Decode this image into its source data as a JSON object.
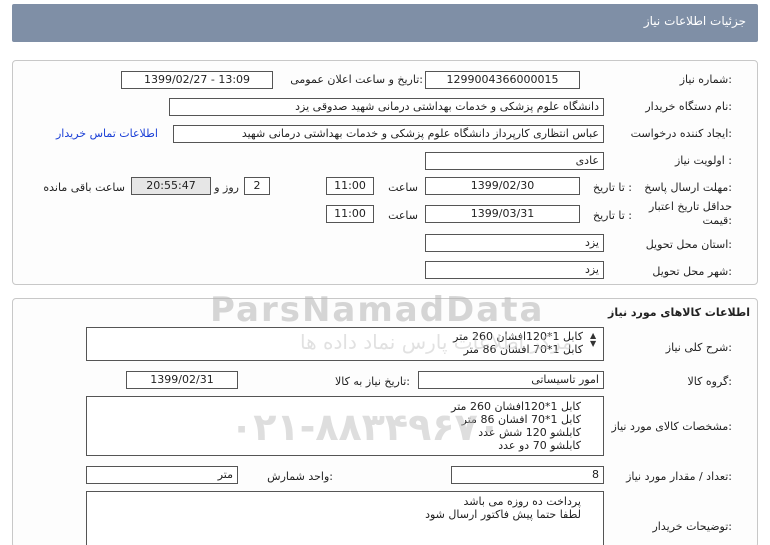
{
  "window": {
    "title": "جزئیات اطلاعات نیاز"
  },
  "header": {
    "need_number_label": "شماره نیاز:",
    "need_number": "1299004366000015",
    "announce_label": "تاریخ و ساعت اعلان عمومی:",
    "announce_value": "1399/02/27 - 13:09",
    "buyer_org_label": "نام دستگاه خریدار:",
    "buyer_org": "دانشگاه علوم پزشکی و خدمات بهداشتی درمانی شهید صدوقی یزد",
    "creator_label": "ایجاد کننده درخواست:",
    "creator": "عباس انتظاری کارپرداز دانشگاه علوم پزشکی و خدمات بهداشتی درمانی شهید",
    "contact_link": "اطلاعات تماس خریدار",
    "priority_label": "اولویت نیاز :",
    "priority": "عادی",
    "reply_deadline_label": "مهلت ارسال پاسخ:",
    "to_date_label": "تا تاریخ :",
    "reply_date": "1399/02/30",
    "time_label": "ساعت",
    "reply_time": "11:00",
    "days": "2",
    "days_label": "روز و",
    "remaining_time": "20:55:47",
    "remaining_label": "ساعت باقی مانده",
    "validity_label": "حداقل تاریخ اعتبار قیمت:",
    "validity_to_label": "تا تاریخ :",
    "validity_date": "1399/03/31",
    "validity_time_label": "ساعت",
    "validity_time": "11:00",
    "province_label": "استان محل تحویل:",
    "province": "یزد",
    "city_label": "شهر محل تحویل:",
    "city": "یزد"
  },
  "goods": {
    "section_title": "اطلاعات کالاهای مورد نیاز",
    "desc_label": "شرح کلی نیاز:",
    "desc_lines": [
      "کابل 1*120افشان 260 متر",
      "کابل 1*70 افشان 86 متر"
    ],
    "group_label": "گروه کالا:",
    "group": "امور تاسیساتی",
    "need_date_label": "تاریخ نیاز به کالا:",
    "need_date": "1399/02/31",
    "specs_label": "مشخصات کالای مورد نیاز:",
    "specs_lines": [
      "کابل 1*120افشان 260 متر",
      "کابل 1*70 افشان 86 متر",
      "کابلشو 120 شش عدد",
      "کابلشو 70 دو عدد"
    ],
    "qty_label": "تعداد / مقدار مورد نیاز:",
    "qty": "8",
    "unit_label": "واحد شمارش:",
    "unit": "متر",
    "notes_label": "توضیحات خریدار:",
    "notes_lines": [
      "پرداخت ده روزه می باشد",
      "لطفا حتما پیش فاکتور ارسال شود"
    ]
  },
  "watermark": {
    "brand": "ParsNamadData",
    "sub": "مرکز اطلاعات پارس نماد داده ها",
    "phone": "۰۲۱-۸۸۳۴۹۶۷۰"
  }
}
